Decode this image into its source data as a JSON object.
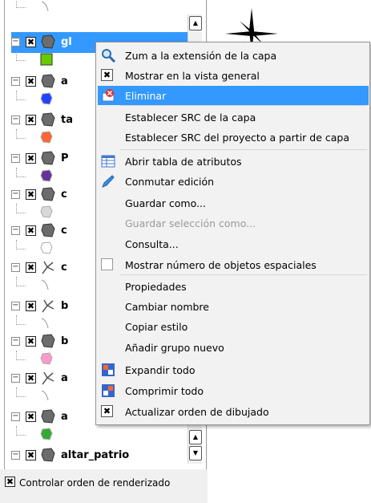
{
  "layers": [
    {
      "name": "gl",
      "selected": true,
      "fill": "#66cc00"
    },
    {
      "name": "a",
      "selected": false,
      "fill": "#2244ff"
    },
    {
      "name": "ta",
      "selected": false,
      "fill": "#ff6633"
    },
    {
      "name": "P",
      "selected": false,
      "fill": "#663399"
    },
    {
      "name": "c",
      "selected": false,
      "fill": "#d8d8d8"
    },
    {
      "name": "c",
      "selected": false,
      "fill": "#ffffff"
    },
    {
      "name": "c",
      "selected": false,
      "fill": "#ffffff"
    },
    {
      "name": "b",
      "selected": false,
      "fill": "#ffffff"
    },
    {
      "name": "b",
      "selected": false,
      "fill": "#ff99cc"
    },
    {
      "name": "a",
      "selected": false,
      "fill": "#ffffff"
    },
    {
      "name": "a",
      "selected": false,
      "fill": "#33aa33"
    },
    {
      "name": "altar_patrio",
      "selected": false,
      "fill": "#ffffff"
    }
  ],
  "bottom_checkbox": {
    "label": "Controlar orden de renderizado",
    "checked": true
  },
  "menu": {
    "items": [
      {
        "label": "Zum a la extensión de la capa",
        "icon": "zoom-icon",
        "enabled": true,
        "highlighted": false
      },
      {
        "label": "Mostrar en la vista general",
        "icon": "checkbox-checked",
        "enabled": true,
        "highlighted": false
      },
      {
        "label": "Eliminar",
        "icon": "remove-layer-icon",
        "enabled": true,
        "highlighted": true
      },
      {
        "label": "Establecer SRC de la capa",
        "icon": "",
        "enabled": true,
        "highlighted": false
      },
      {
        "label": "Establecer SRC del proyecto a partir de capa",
        "icon": "",
        "enabled": true,
        "highlighted": false
      },
      {
        "label": "Abrir tabla de atributos",
        "icon": "table-icon",
        "enabled": true,
        "highlighted": false
      },
      {
        "label": "Conmutar edición",
        "icon": "pencil-icon",
        "enabled": true,
        "highlighted": false
      },
      {
        "label": "Guardar como...",
        "icon": "",
        "enabled": true,
        "highlighted": false
      },
      {
        "label": "Guardar selección como...",
        "icon": "",
        "enabled": false,
        "highlighted": false
      },
      {
        "label": "Consulta...",
        "icon": "",
        "enabled": true,
        "highlighted": false
      },
      {
        "label": "Mostrar número de objetos espaciales",
        "icon": "checkbox-empty",
        "enabled": true,
        "highlighted": false
      },
      {
        "label": "Propiedades",
        "icon": "",
        "enabled": true,
        "highlighted": false
      },
      {
        "label": "Cambiar nombre",
        "icon": "",
        "enabled": true,
        "highlighted": false
      },
      {
        "label": "Copiar estilo",
        "icon": "",
        "enabled": true,
        "highlighted": false
      },
      {
        "label": "Añadir grupo nuevo",
        "icon": "",
        "enabled": true,
        "highlighted": false
      },
      {
        "label": "Expandir todo",
        "icon": "expand-all-icon",
        "enabled": true,
        "highlighted": false
      },
      {
        "label": "Comprimir todo",
        "icon": "collapse-all-icon",
        "enabled": true,
        "highlighted": false
      },
      {
        "label": "Actualizar orden de dibujado",
        "icon": "checkbox-checked",
        "enabled": true,
        "highlighted": false
      }
    ]
  }
}
